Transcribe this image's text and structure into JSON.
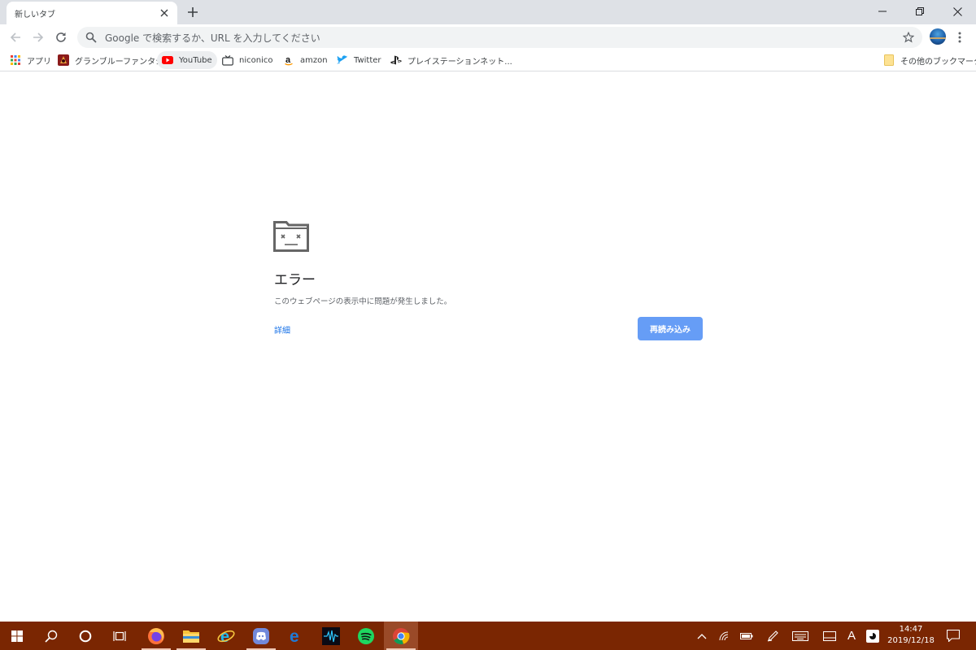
{
  "browser": {
    "tab": {
      "title": "新しいタブ",
      "close_icon": "close-icon"
    },
    "new_tab_icon": "plus-icon",
    "window_controls": [
      "minimize-icon",
      "restore-icon",
      "close-icon"
    ],
    "toolbar": {
      "back_icon": "arrow-left-icon",
      "forward_icon": "arrow-right-icon",
      "reload_icon": "reload-icon",
      "omnibox_placeholder": "Google で検索するか、URL を入力してください",
      "star_icon": "star-icon",
      "menu_icon": "kebab-menu-icon"
    },
    "bookmarks": [
      {
        "label": "アプリ",
        "icon": "apps-grid-icon"
      },
      {
        "label": "グランブルーファンタジー",
        "icon": "granblue-icon"
      },
      {
        "label": "YouTube",
        "icon": "youtube-icon"
      },
      {
        "label": "niconico",
        "icon": "niconico-icon"
      },
      {
        "label": "amzon",
        "icon": "amazon-icon"
      },
      {
        "label": "Twitter",
        "icon": "twitter-icon"
      },
      {
        "label": "プレイステーションネット...",
        "icon": "playstation-icon"
      }
    ],
    "other_bookmarks": {
      "label": "その他のブックマーク",
      "icon": "folder-icon"
    }
  },
  "error_page": {
    "icon": "sad-folder-icon",
    "title": "エラー",
    "message": "このウェブページの表示中に問題が発生しました。",
    "details_link": "詳細",
    "reload_button": "再読み込み"
  },
  "taskbar": {
    "items": [
      "windows-start-icon",
      "search-icon",
      "cortana-icon",
      "task-view-icon",
      "firefox-icon",
      "file-explorer-icon",
      "internet-explorer-icon",
      "discord-icon",
      "edge-icon",
      "audio-app-icon",
      "spotify-icon",
      "chrome-icon"
    ],
    "tray": [
      "chevron-up-icon",
      "wifi-icon",
      "battery-icon",
      "pen-icon",
      "touch-keyboard-icon",
      "tablet-icon",
      "ime-icon",
      "app-tray-icon"
    ],
    "ime_label": "A",
    "clock_time": "14:47",
    "clock_date": "2019/12/18",
    "notifications_icon": "notifications-icon"
  },
  "colors": {
    "tab_strip": "#dee1e6",
    "omnibox": "#f1f3f4",
    "link": "#1a73e8",
    "reload_button": "#669df6",
    "taskbar": "#7a2602"
  }
}
